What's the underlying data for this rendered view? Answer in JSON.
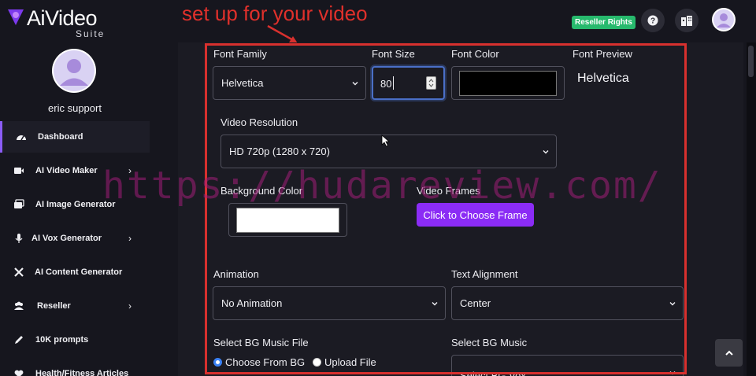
{
  "brand": {
    "name": "AiVideo",
    "sub": "Suite"
  },
  "annotation": "set up for your video",
  "header": {
    "reseller_badge": "Reseller Rights",
    "help_icon": "help-icon",
    "building_icon": "building-icon"
  },
  "user": {
    "name": "eric support"
  },
  "sidebar": {
    "items": [
      {
        "label": "Dashboard",
        "icon": "dashboard-icon",
        "active": true,
        "has_submenu": false
      },
      {
        "label": "AI Video Maker",
        "icon": "video-camera-icon",
        "has_submenu": true
      },
      {
        "label": "AI Image Generator",
        "icon": "images-icon",
        "has_submenu": false
      },
      {
        "label": "AI Vox Generator",
        "icon": "microphone-icon",
        "has_submenu": true
      },
      {
        "label": "AI Content Generator",
        "icon": "tools-icon",
        "has_submenu": false
      },
      {
        "label": "Reseller",
        "icon": "users-icon",
        "has_submenu": true
      },
      {
        "label": "10K prompts",
        "icon": "pen-icon",
        "has_submenu": false
      },
      {
        "label": "Health/Fitness Articles",
        "icon": "heart-icon",
        "has_submenu": false
      }
    ]
  },
  "form": {
    "font_family": {
      "label": "Font Family",
      "value": "Helvetica"
    },
    "font_size": {
      "label": "Font Size",
      "value": "80"
    },
    "font_color": {
      "label": "Font Color",
      "value": "#000000"
    },
    "font_preview": {
      "label": "Font Preview",
      "text": "Helvetica"
    },
    "video_resolution": {
      "label": "Video Resolution",
      "value": "HD 720p (1280 x 720)"
    },
    "background_color": {
      "label": "Background Color",
      "value": "#ffffff"
    },
    "video_frames": {
      "label": "Video Frames",
      "button": "Click to Choose Frame"
    },
    "animation": {
      "label": "Animation",
      "value": "No Animation"
    },
    "text_alignment": {
      "label": "Text Alignment",
      "value": "Center"
    },
    "bg_music_file": {
      "label": "Select BG Music File",
      "options": [
        {
          "label": "Choose From BG",
          "checked": true
        },
        {
          "label": "Upload File",
          "checked": false
        }
      ]
    },
    "bg_music": {
      "label": "Select BG Music",
      "value": "Select BG Vox"
    }
  },
  "watermark": "https://hudareview.com/",
  "colors": {
    "accent": "#8b2cf5",
    "annotation": "#d8302e",
    "badge": "#27b96d"
  }
}
